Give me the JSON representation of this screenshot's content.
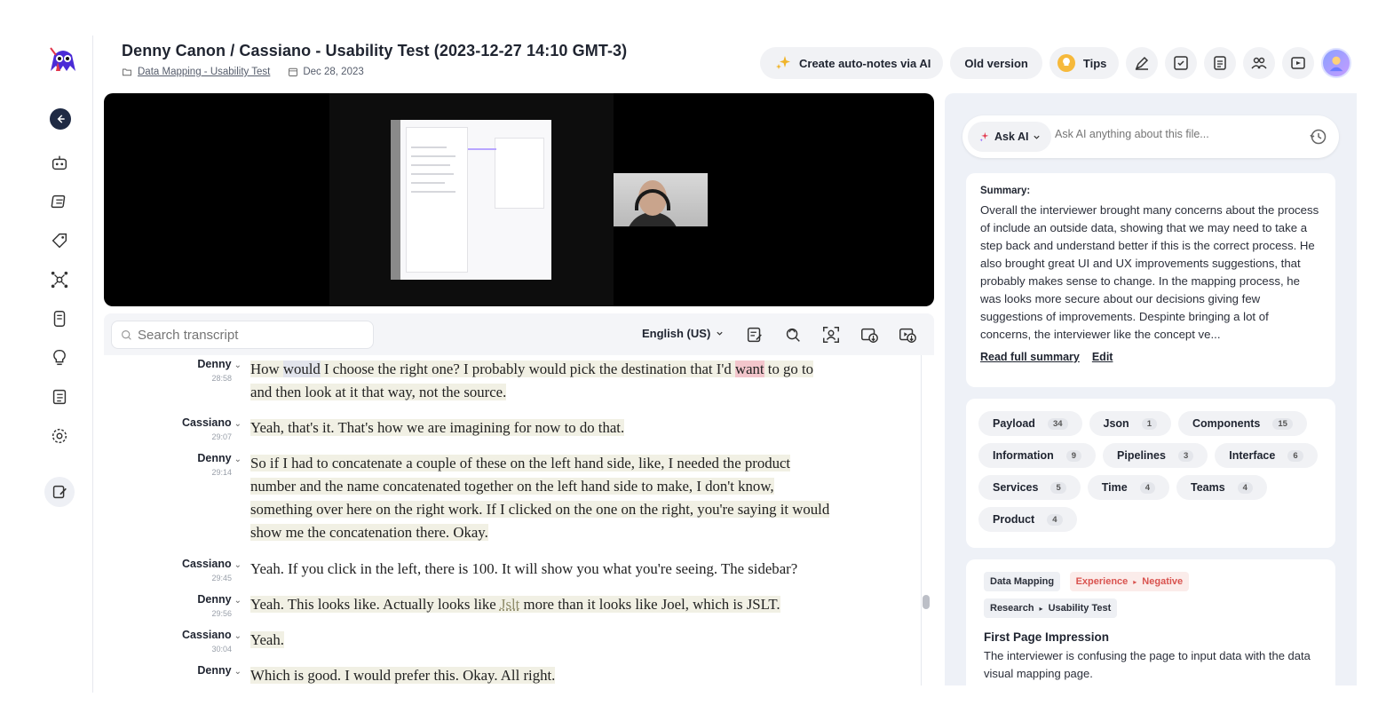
{
  "header": {
    "title": "Denny Canon / Cassiano - Usability Test (2023-12-27 14:10 GMT-3)",
    "folder_link": "Data Mapping - Usability Test",
    "date": "Dec 28, 2023"
  },
  "toolbar": {
    "auto_notes_label": "Create auto-notes via AI",
    "old_version_label": "Old version",
    "tips_label": "Tips"
  },
  "transcript": {
    "search_placeholder": "Search transcript",
    "language": "English (US)",
    "entries": [
      {
        "speaker": "Denny",
        "time": "28:58"
      },
      {
        "speaker": "Cassiano",
        "time": "29:07",
        "text": "Yeah, that's it. That's how we are imagining for now to do that."
      },
      {
        "speaker": "Denny",
        "time": "29:14",
        "text": "So if I had to concatenate a couple of these on the left hand side, like, I needed the product number and the name concatenated together on the left hand side to make, I don't know, something over here on the right work. If I clicked on the one on the right, you're saying it would show me the concatenation there. Okay."
      },
      {
        "speaker": "Cassiano",
        "time": "29:45",
        "text": "Yeah. If you click in the left, there is 100. It will show you what you're seeing. The sidebar?"
      },
      {
        "speaker": "Denny",
        "time": "29:56"
      },
      {
        "speaker": "Cassiano",
        "time": "30:04",
        "text": "Yeah."
      },
      {
        "speaker": "Denny",
        "time": "",
        "text": "Which is good. I would prefer this. Okay. All right."
      }
    ],
    "entry0_parts": {
      "p1": "How ",
      "p2": "would",
      "p3": " I choose the right one? I probably would pick the destination that I'd ",
      "p4": "want",
      "p5": " to go to and then look at it that way, not the source."
    },
    "entry4_parts": {
      "p1": "Yeah. This looks like. Actually looks like ",
      "p2": "Jslt",
      "p3": " more than it looks like Joel, which is JSLT."
    }
  },
  "ai": {
    "ask_label": "Ask AI",
    "ask_placeholder": "Ask AI anything about this file...",
    "summary_label": "Summary:",
    "summary_text": "Overall the interviewer brought many concerns about the process of include an outside data, showing that we may need to take a step back and understand better if this is the correct process. He also brought great UI and UX improvements suggestions, that probably makes sense to change. In the mapping process, he was looks more secure about our decisions giving few suggestions of improvements. Despinte bringing a lot of concerns, the interviewer like the concept ve...",
    "read_full_label": "Read full summary",
    "edit_label": "Edit"
  },
  "tags": [
    {
      "name": "Payload",
      "count": "34"
    },
    {
      "name": "Json",
      "count": "1"
    },
    {
      "name": "Components",
      "count": "15"
    },
    {
      "name": "Information",
      "count": "9"
    },
    {
      "name": "Pipelines",
      "count": "3"
    },
    {
      "name": "Interface",
      "count": "6"
    },
    {
      "name": "Services",
      "count": "5"
    },
    {
      "name": "Time",
      "count": "4"
    },
    {
      "name": "Teams",
      "count": "4"
    },
    {
      "name": "Product",
      "count": "4"
    }
  ],
  "note": {
    "chip1": "Data Mapping",
    "chip2a": "Experience",
    "chip2b": "Negative",
    "chip3a": "Research",
    "chip3b": "Usability Test",
    "title": "First Page Impression",
    "body": "The interviewer is confusing the page to input data with the data visual mapping page."
  },
  "colors": {
    "accent_negative": "#d9534f",
    "highlight": "#f1f0e4",
    "highlight_red": "#f3c6cc"
  }
}
